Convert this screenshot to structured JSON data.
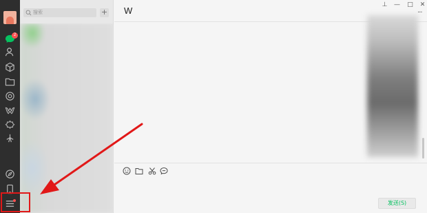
{
  "sidebar": {
    "unread_badge": "2",
    "icons": [
      "avatar",
      "chat-icon",
      "contacts-icon",
      "favorites-icon",
      "files-icon",
      "moments-icon",
      "channels-icon",
      "search-icon",
      "mini-programs-icon",
      "phone-icon",
      "menu-icon"
    ]
  },
  "list": {
    "search_placeholder": "搜索",
    "add_label": "+"
  },
  "chat": {
    "title": "W",
    "more": "···",
    "pin": "⊥",
    "minimize": "—",
    "maximize": "□",
    "close": "✕",
    "toolbar": [
      "emoji-icon",
      "folder-icon",
      "scissors-icon",
      "chat-history-icon"
    ],
    "send_label": "发送(S)"
  },
  "colors": {
    "accent": "#07c160",
    "annotation": "#e11818",
    "badge": "#fa5151"
  }
}
